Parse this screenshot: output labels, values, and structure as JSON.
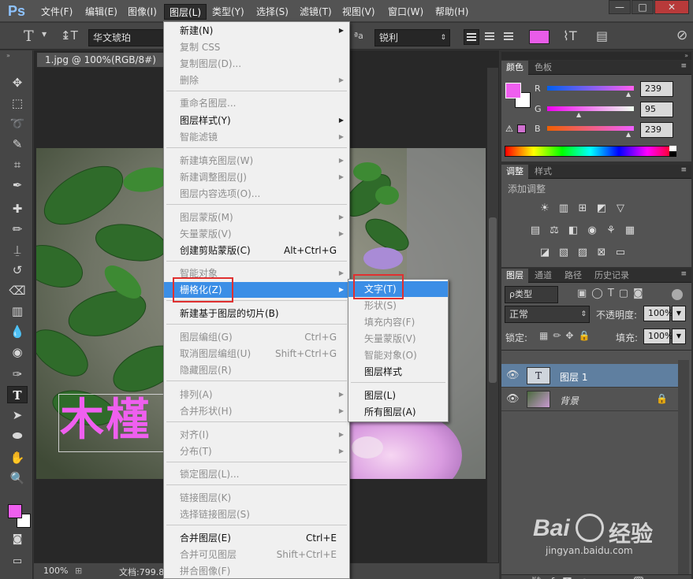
{
  "menubar": {
    "logo": "Ps",
    "items": [
      "文件(F)",
      "编辑(E)",
      "图像(I)",
      "图层(L)",
      "类型(Y)",
      "选择(S)",
      "滤镜(T)",
      "视图(V)",
      "窗口(W)",
      "帮助(H)"
    ],
    "window_controls": [
      "—",
      "□",
      "✕"
    ]
  },
  "options": {
    "font_family": "华文琥珀",
    "aa_label": "ªa",
    "aa_value": "锐利",
    "color": "#e85ce8"
  },
  "document": {
    "tab_title": "1.jpg @ 100%(RGB/8#)",
    "zoom": "100%",
    "doc_info": "文档:799.8",
    "text_layer": "木槿"
  },
  "color_panel": {
    "tabs": [
      "颜色",
      "色板"
    ],
    "r_label": "R",
    "r_value": "239",
    "g_label": "G",
    "g_value": "95",
    "b_label": "B",
    "b_value": "239",
    "fg_color": "#ef5fef",
    "bg_color": "#ffffff"
  },
  "adjust_panel": {
    "tabs": [
      "调整",
      "样式"
    ],
    "title": "添加调整"
  },
  "layers_panel": {
    "tabs": [
      "图层",
      "通道",
      "路径",
      "历史记录"
    ],
    "kind_filter": "ρ类型",
    "blend_mode": "正常",
    "opacity_label": "不透明度:",
    "opacity_value": "100%",
    "lock_label": "锁定:",
    "fill_label": "填充:",
    "fill_value": "100%",
    "layers": [
      {
        "name": "图层 1",
        "type_glyph": "T"
      },
      {
        "name": "背景"
      }
    ]
  },
  "layer_menu": {
    "items": [
      {
        "label": "新建(N)",
        "arrow": true
      },
      {
        "label": "复制 CSS",
        "disabled": true
      },
      {
        "label": "复制图层(D)...",
        "disabled": true
      },
      {
        "label": "删除",
        "disabled": true,
        "arrow": true
      },
      {
        "label": "重命名图层...",
        "disabled": true
      },
      {
        "label": "图层样式(Y)",
        "arrow": true
      },
      {
        "label": "智能滤镜",
        "disabled": true,
        "arrow": true
      },
      {
        "label": "新建填充图层(W)",
        "disabled": true,
        "arrow": true
      },
      {
        "label": "新建调整图层(J)",
        "disabled": true,
        "arrow": true
      },
      {
        "label": "图层内容选项(O)...",
        "disabled": true
      },
      {
        "label": "图层蒙版(M)",
        "disabled": true,
        "arrow": true
      },
      {
        "label": "矢量蒙版(V)",
        "disabled": true,
        "arrow": true
      },
      {
        "label": "创建剪贴蒙版(C)",
        "shortcut": "Alt+Ctrl+G"
      },
      {
        "label": "智能对象",
        "disabled": true,
        "arrow": true
      },
      {
        "label": "栅格化(Z)",
        "arrow": true,
        "highlighted": true
      },
      {
        "label": "新建基于图层的切片(B)"
      },
      {
        "label": "图层编组(G)",
        "disabled": true,
        "shortcut": "Ctrl+G"
      },
      {
        "label": "取消图层编组(U)",
        "disabled": true,
        "shortcut": "Shift+Ctrl+G"
      },
      {
        "label": "隐藏图层(R)",
        "disabled": true
      },
      {
        "label": "排列(A)",
        "disabled": true,
        "arrow": true
      },
      {
        "label": "合并形状(H)",
        "disabled": true,
        "arrow": true
      },
      {
        "label": "对齐(I)",
        "disabled": true,
        "arrow": true
      },
      {
        "label": "分布(T)",
        "disabled": true,
        "arrow": true
      },
      {
        "label": "锁定图层(L)...",
        "disabled": true
      },
      {
        "label": "链接图层(K)",
        "disabled": true
      },
      {
        "label": "选择链接图层(S)",
        "disabled": true
      },
      {
        "label": "合并图层(E)",
        "shortcut": "Ctrl+E"
      },
      {
        "label": "合并可见图层",
        "disabled": true,
        "shortcut": "Shift+Ctrl+E"
      },
      {
        "label": "拼合图像(F)",
        "disabled": true
      }
    ]
  },
  "rasterize_submenu": {
    "items": [
      {
        "label": "文字(T)",
        "highlighted": true
      },
      {
        "label": "形状(S)",
        "disabled": true
      },
      {
        "label": "填充内容(F)",
        "disabled": true
      },
      {
        "label": "矢量蒙版(V)",
        "disabled": true
      },
      {
        "label": "智能对象(O)",
        "disabled": true
      },
      {
        "label": "图层样式"
      },
      {
        "label": "图层(L)"
      },
      {
        "label": "所有图层(A)"
      }
    ]
  },
  "watermark": {
    "brand": "Bai",
    "brand_cn": "经验",
    "url": "jingyan.baidu.com"
  }
}
